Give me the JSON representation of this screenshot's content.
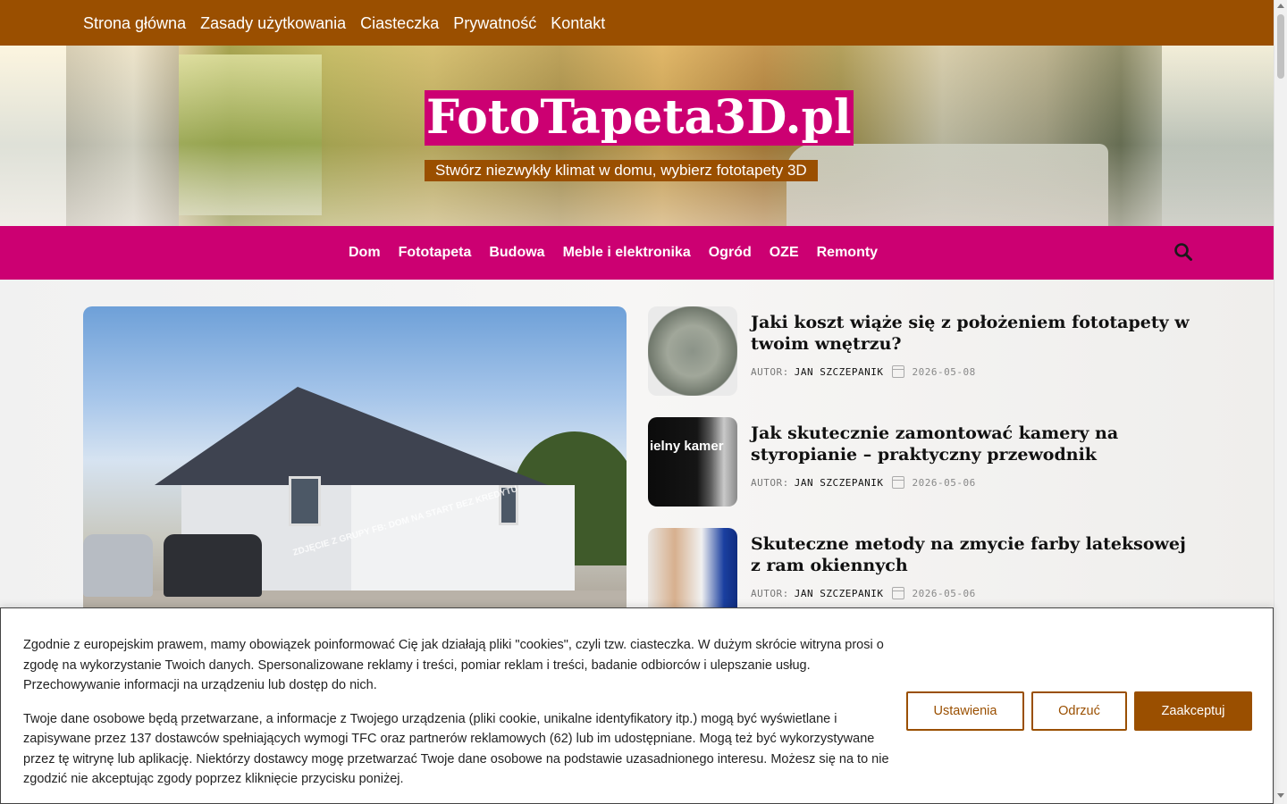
{
  "top_nav": {
    "items": [
      "Strona główna",
      "Zasady użytkowania",
      "Ciasteczka",
      "Prywatność",
      "Kontakt"
    ]
  },
  "header": {
    "site_title": "FotoTapeta3D.pl",
    "tagline": "Stwórz niezwykły klimat w domu, wybierz fototapety 3D"
  },
  "category_nav": {
    "items": [
      "Dom",
      "Fototapeta",
      "Budowa",
      "Meble i elektronika",
      "Ogród",
      "OZE",
      "Remonty"
    ],
    "search_icon": "search-icon"
  },
  "featured_image": {
    "watermark": "ZDJĘCIE Z GRUPY FB: DOM NA START BEZ KREDYTU"
  },
  "posts": [
    {
      "title": "Jaki koszt wiąże się z położeniem fototapety w twoim wnętrzu?",
      "author_label": "AUTOR:",
      "author": "JAN SZCZEPANIK",
      "date": "2026-05-08"
    },
    {
      "title": "Jak skutecznie zamontować kamery na styropianie – praktyczny przewodnik",
      "author_label": "AUTOR:",
      "author": "JAN SZCZEPANIK",
      "date": "2026-05-06",
      "thumb_text": "ielny kamer"
    },
    {
      "title": "Skuteczne metody na zmycie farby lateksowej z ram okiennych",
      "author_label": "AUTOR:",
      "author": "JAN SZCZEPANIK",
      "date": "2026-05-06"
    }
  ],
  "cookie_banner": {
    "paragraph1": "Zgodnie z europejskim prawem, mamy obowiązek poinformować Cię jak działają pliki \"cookies\", czyli tzw. ciasteczka. W dużym skrócie witryna prosi o zgodę na wykorzystanie Twoich danych. Spersonalizowane reklamy i treści, pomiar reklam i treści, badanie odbiorców i ulepszanie usług. Przechowywanie informacji na urządzeniu lub dostęp do nich.",
    "paragraph2": "Twoje dane osobowe będą przetwarzane, a informacje z Twojego urządzenia (pliki cookie, unikalne identyfikatory itp.) mogą być wyświetlane i zapisywane przez 137 dostawców spełniających wymogi TFC oraz partnerów reklamowych (62) lub im udostępniane. Mogą też być wykorzystywane przez tę witrynę lub aplikację. Niektórzy dostawcy mogę przetwarzać Twoje dane osobowe na podstawie uzasadnionego interesu. Możesz się na to nie zgodzić nie akceptując zgody poprzez kliknięcie przycisku poniżej.",
    "settings_label": "Ustawienia",
    "reject_label": "Odrzuć",
    "accept_label": "Zaakceptuj"
  },
  "colors": {
    "brand_brown": "#9a4f00",
    "brand_magenta": "#cc0072"
  }
}
